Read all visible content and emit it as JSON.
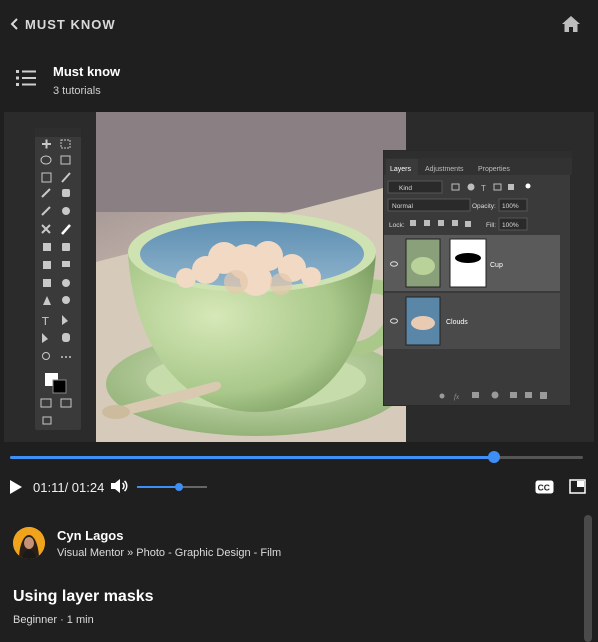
{
  "header": {
    "back_label": "MUST KNOW"
  },
  "course": {
    "title": "Must know",
    "subtitle": "3 tutorials"
  },
  "player": {
    "time": "01:11/ 01:24",
    "progress_fraction": 0.845,
    "volume_fraction": 0.6,
    "screen": {
      "tabs": [
        "Layers",
        "Adjustments",
        "Properties"
      ],
      "kind": "Kind",
      "blend_mode": "Normal",
      "opacity_label": "Opacity:",
      "opacity": "100%",
      "lock_label": "Lock:",
      "fill_label": "Fill:",
      "fill": "100%",
      "layers": [
        "Cup",
        "Clouds"
      ]
    }
  },
  "author": {
    "name": "Cyn Lagos",
    "role": "Visual Mentor » Photo - Graphic Design - Film"
  },
  "video": {
    "title": "Using layer masks",
    "meta": "Beginner · 1 min"
  },
  "colors": {
    "accent": "#3e8ff5",
    "avatar_bg": "#f0a41e",
    "background": "#1f1f1f"
  },
  "icons": [
    "chevron-left-icon",
    "home-icon",
    "list-icon",
    "play-icon",
    "volume-icon",
    "cc-icon",
    "picture-in-picture-icon"
  ]
}
